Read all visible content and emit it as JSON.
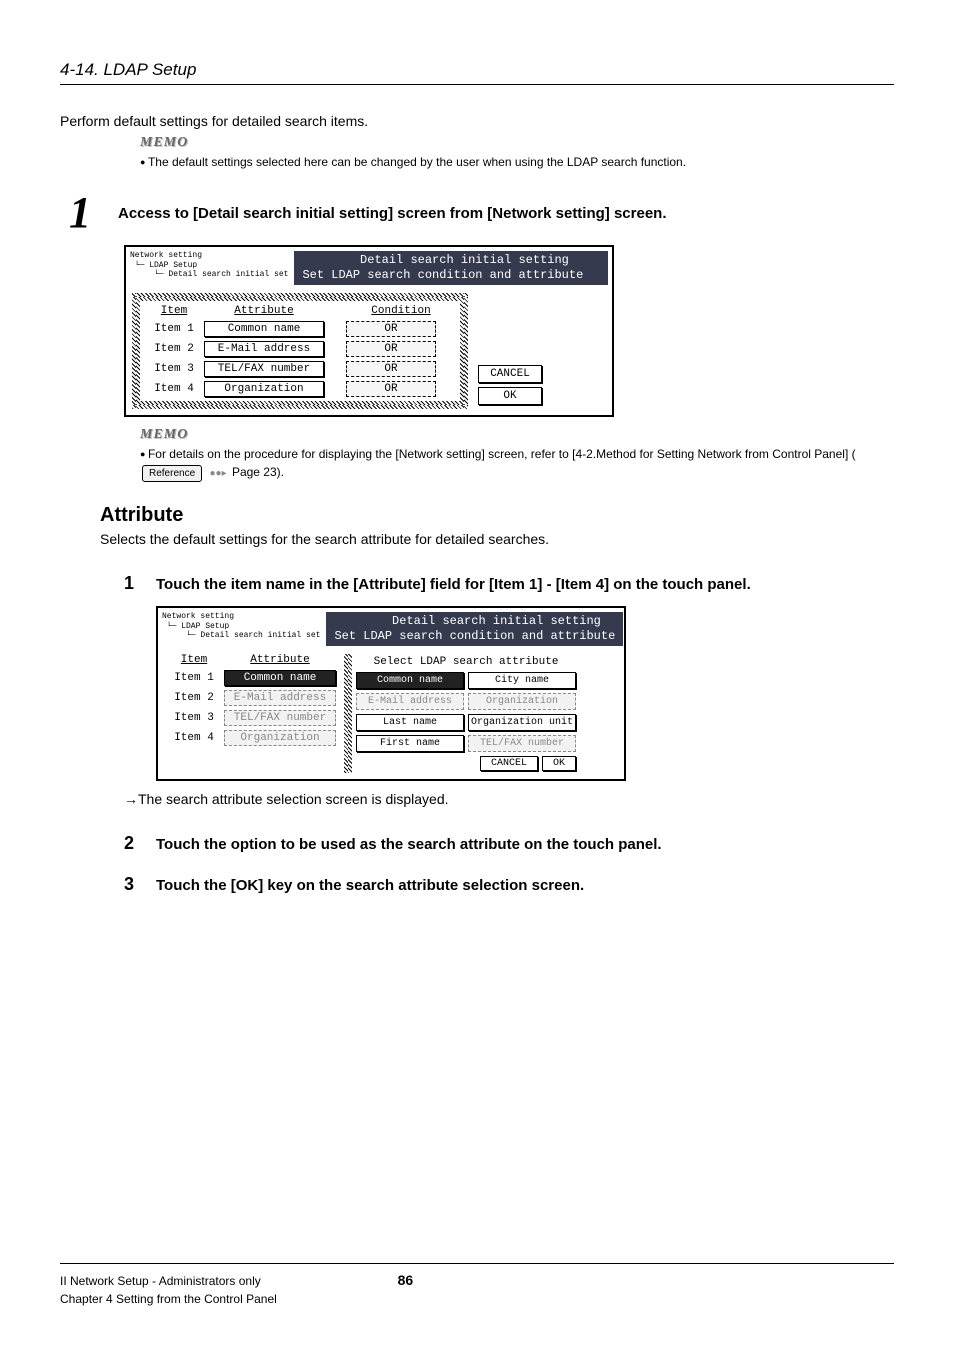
{
  "section_title": "4-14. LDAP Setup",
  "intro": "Perform default settings for detailed search items.",
  "memo1": {
    "label": "MEMO",
    "text": "The default settings selected here can be changed by the user when using the LDAP search function."
  },
  "step1": {
    "num": "1",
    "text": "Access to [Detail search initial setting] screen from [Network setting] screen."
  },
  "panel1": {
    "breadcrumb": "Network setting\n └─ LDAP Setup\n     └─ Detail search initial set",
    "title": "        Detail search initial setting\nSet LDAP search condition and attribute",
    "headers": {
      "item": "Item",
      "attr": "Attribute",
      "cond": "Condition"
    },
    "rows": [
      {
        "item": "Item 1",
        "attr": "Common name",
        "cond": "OR"
      },
      {
        "item": "Item 2",
        "attr": "E-Mail address",
        "cond": "OR"
      },
      {
        "item": "Item 3",
        "attr": "TEL/FAX number",
        "cond": "OR"
      },
      {
        "item": "Item 4",
        "attr": "Organization",
        "cond": "OR"
      }
    ],
    "cancel": "CANCEL",
    "ok": "OK"
  },
  "memo2": {
    "label": "MEMO",
    "text_a": "For details on the procedure for displaying the [Network setting] screen, refer to [4-2.Method for Setting Network from Control Panel] (",
    "ref": "Reference",
    "text_b": " Page 23)."
  },
  "attribute": {
    "heading": "Attribute",
    "desc": "Selects the default settings for the search attribute for detailed searches."
  },
  "sub1": {
    "num": "1",
    "text": "Touch the item name in the [Attribute] field for [Item 1] - [Item 4] on the touch panel."
  },
  "panel2": {
    "breadcrumb": "Network setting\n └─ LDAP Setup\n     └─ Detail search initial set",
    "title": "        Detail search initial setting\nSet LDAP search condition and attribute",
    "headers": {
      "item": "Item",
      "attr": "Attribute"
    },
    "rows": [
      {
        "item": "Item 1",
        "attr": "Common name",
        "selected": true
      },
      {
        "item": "Item 2",
        "attr": "E-Mail address",
        "selected": false
      },
      {
        "item": "Item 3",
        "attr": "TEL/FAX number",
        "selected": false
      },
      {
        "item": "Item 4",
        "attr": "Organization",
        "selected": false
      }
    ],
    "right_title": "Select LDAP search attribute",
    "options": [
      {
        "label": "Common name",
        "state": "sel"
      },
      {
        "label": "City name",
        "state": "normal"
      },
      {
        "label": "E-Mail address",
        "state": "ghost"
      },
      {
        "label": "Organization",
        "state": "ghost"
      },
      {
        "label": "Last name",
        "state": "normal"
      },
      {
        "label": "Organization unit",
        "state": "normal"
      },
      {
        "label": "First name",
        "state": "normal"
      },
      {
        "label": "TEL/FAX number",
        "state": "ghost"
      }
    ],
    "cancel": "CANCEL",
    "ok": "OK"
  },
  "result": "→The search attribute selection screen is displayed.",
  "sub2": {
    "num": "2",
    "text": "Touch the option to be used as the search attribute on the touch panel."
  },
  "sub3": {
    "num": "3",
    "text": "Touch the [OK] key on the search attribute selection screen."
  },
  "footer": {
    "left1": "II Network Setup - Administrators only",
    "left2": "Chapter 4 Setting from the Control Panel",
    "page": "86"
  }
}
